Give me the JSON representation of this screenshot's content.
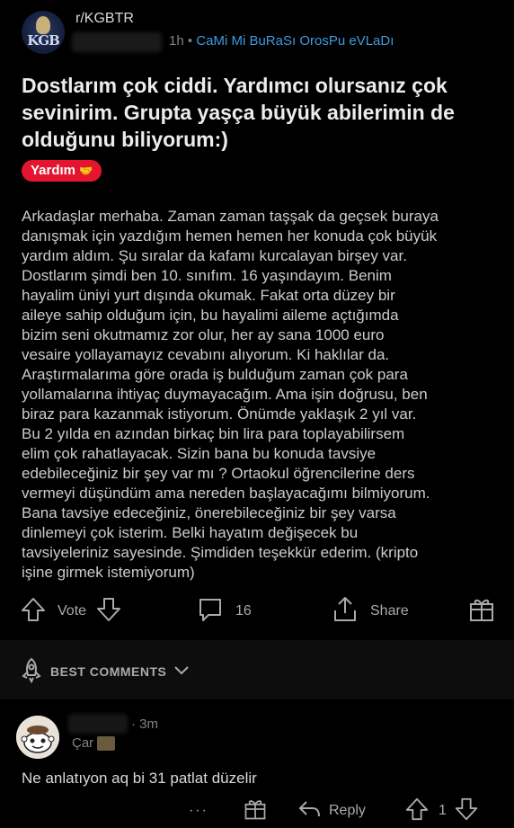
{
  "post": {
    "subreddit": "r/KGBTR",
    "avatar_text": "KGB",
    "time": "1h",
    "separator": "•",
    "user_flair": "CaMi Mi BuRaSı OrosPu eVLaDı",
    "title": "Dostlarım çok ciddi. Yardımcı olursanız çok sevinirim. Grupta yaşça büyük abilerimin de olduğunu biliyorum:)",
    "tag": "Yardım",
    "tag_color": "#e5152f",
    "body_lines": [
      "Arkadaşlar merhaba. Zaman zaman taşşak da geçsek buraya",
      "danışmak için yazdığım hemen hemen her konuda çok büyük",
      "yardım aldım. Şu sıralar da kafamı kurcalayan birşey var.",
      "Dostlarım şimdi ben 10. sınıfım. 16 yaşındayım. Benim",
      "hayalim üniyi yurt dışında okumak. Fakat orta düzey bir",
      "aileye sahip olduğum için, bu hayalimi aileme açtığımda",
      "bizim seni okutmamız zor olur, her ay sana 1000 euro",
      "vesaire yollayamayız cevabını alıyorum. Ki haklılar da.",
      "Araştırmalarıma göre orada iş bulduğum zaman çok para",
      "yollamalarına ihtiyaç duymayacağım. Ama işin doğrusu, ben",
      "biraz para kazanmak istiyorum. Önümde yaklaşık 2 yıl var.",
      "Bu 2 yılda en azından birkaç bin lira para toplayabilirsem",
      "elim çok rahatlayacak. Sizin bana bu konuda tavsiye",
      "edebileceğiniz bir şey var mı ? Ortaokul öğrencilerine ders",
      "vermeyi düşündüm ama nereden başlayacağımı bilmiyorum.",
      "Bana tavsiye edeceğiniz, önerebileceğiniz bir şey varsa",
      "dinlemeyi çok isterim. Belki hayatım değişecek bu",
      "tavsiyeleriniz sayesinde. Şimdiden teşekkür ederim. (kripto",
      "işine girmek istemiyorum)"
    ],
    "actions": {
      "vote_label": "Vote",
      "comments_count": "16",
      "share_label": "Share"
    }
  },
  "comments_header": {
    "label": "BEST COMMENTS"
  },
  "comment": {
    "time": "3m",
    "separator": "·",
    "flair": "Çar",
    "text": "Ne anlatıyon aq bi 31 patlat düzelir",
    "more": "···",
    "reply_label": "Reply",
    "score": "1"
  }
}
